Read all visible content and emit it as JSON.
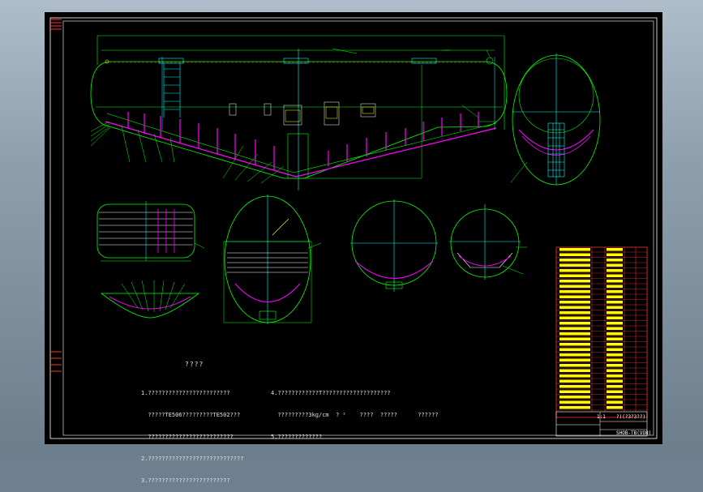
{
  "notes": {
    "title": "????",
    "col1": [
      "1.????????????????????????",
      "  ?????TE506?????????TE502???",
      "  ?????????????????????????",
      "2.????????????????????????????",
      "3.????????????????????????"
    ],
    "col2": [
      "4.????????????T????????????????????",
      "  ?????????3kg/cm  ? ²    ????  ?????      ??????",
      "5.?????????????"
    ]
  },
  "title_block": {
    "scale": "1:1",
    "drawing_name": "?)(?3?3??)",
    "drawing_number": "SHOB-TB(VO8)"
  },
  "colors": {
    "sheet": "#000000",
    "outline": "#00ff00",
    "centerline": "#00ffff",
    "hatch": "#ff00ff",
    "frame": "#ffffff",
    "table_border": "#ff0000",
    "table_text": "#ffff00"
  }
}
